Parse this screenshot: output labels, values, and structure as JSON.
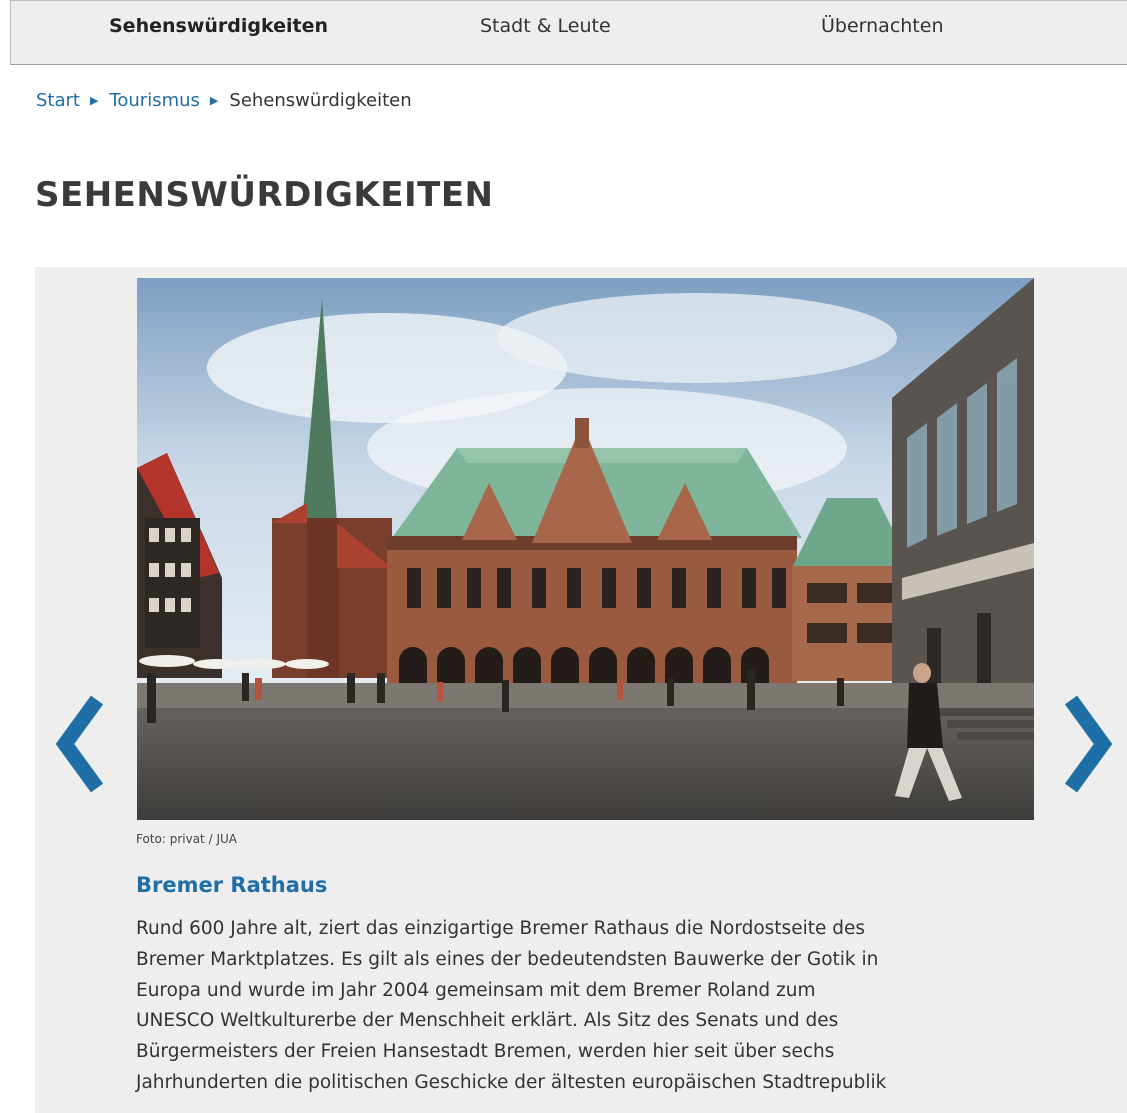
{
  "nav": {
    "items": [
      {
        "label": "Sehenswürdigkeiten",
        "active": true
      },
      {
        "label": "Stadt & Leute",
        "active": false
      },
      {
        "label": "Übernachten",
        "active": false
      }
    ]
  },
  "breadcrumb": {
    "items": [
      "Start",
      "Tourismus",
      "Sehenswürdigkeiten"
    ],
    "separator": "▶"
  },
  "page": {
    "title": "SEHENSWÜRDIGKEITEN"
  },
  "slider": {
    "prev_icon": "chevron-left-icon",
    "next_icon": "chevron-right-icon",
    "photo_credit": "Foto: privat / JUA",
    "slide_title": "Bremer Rathaus",
    "slide_text_lines": [
      "Rund 600 Jahre alt, ziert das einzigartige Bremer Rathaus die Nordostseite des",
      "Bremer Marktplatzes. Es gilt als eines der bedeutendsten Bauwerke der Gotik in",
      "Europa und wurde im Jahr 2004 gemeinsam mit dem Bremer Roland zum",
      "UNESCO Weltkulturerbe der Menschheit erklärt. Als Sitz des Senats und des",
      "Bürgermeisters der Freien Hansestadt Bremen, werden hier seit über sechs",
      "Jahrhunderten die politischen Geschicke der ältesten europäischen Stadtrepublik"
    ]
  },
  "colors": {
    "accent": "#1f6fa6",
    "panel": "#eeeeee",
    "nav_bg": "#eeeeee",
    "text": "#333333"
  }
}
